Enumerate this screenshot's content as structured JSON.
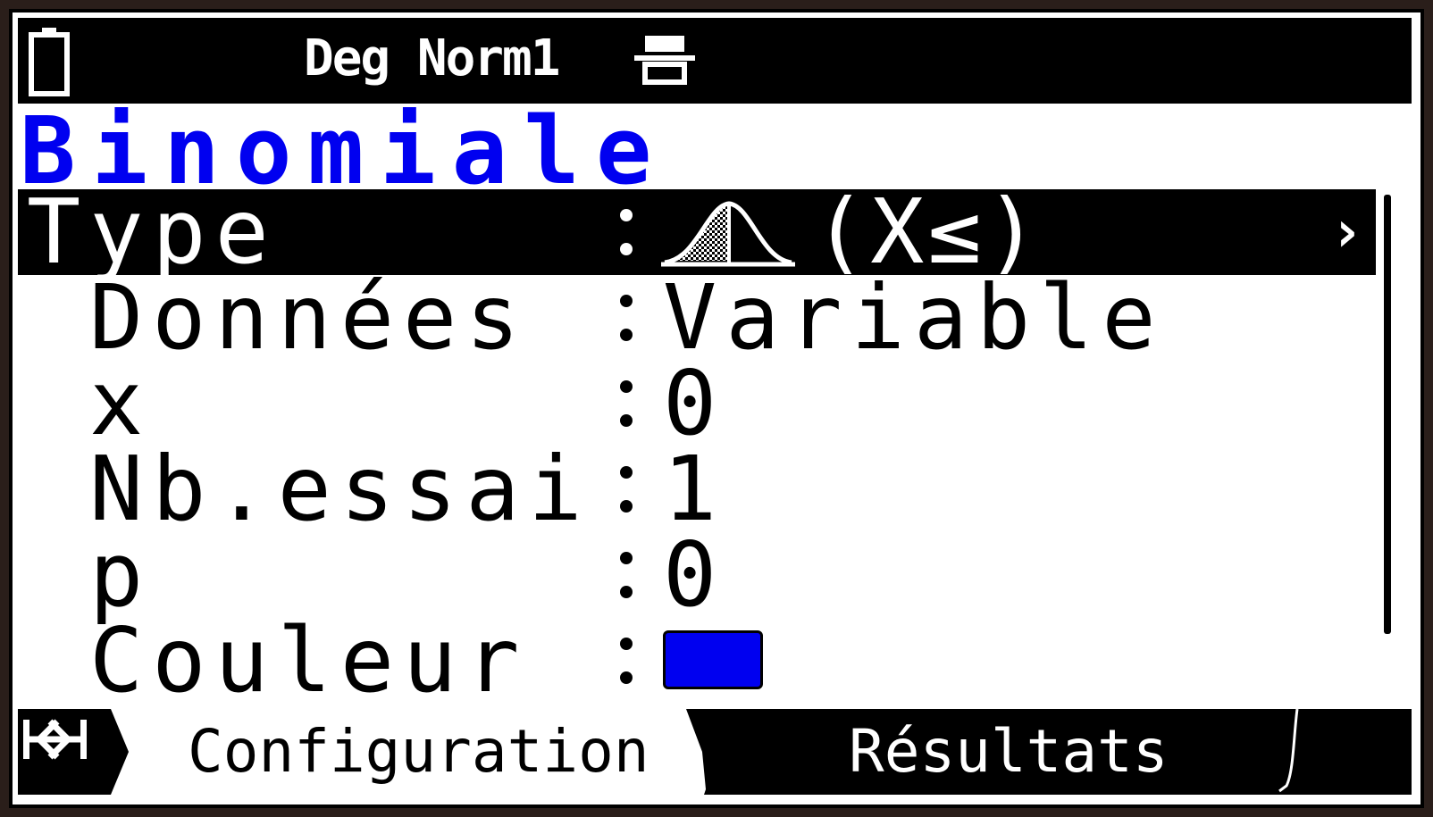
{
  "status": {
    "mode_text": "Deg Norm1",
    "battery_icon": "battery-icon",
    "extra_icon": "display-mode-icon"
  },
  "app_title": "Binomiale",
  "rows": [
    {
      "label": "Type",
      "value_condition": "(X≤)",
      "value_icon": "distribution-lower-tail-icon",
      "selected": true
    },
    {
      "label": "Données",
      "value": "Variable"
    },
    {
      "label": "x",
      "value": "0"
    },
    {
      "label": "Nb.essai",
      "value": "1"
    },
    {
      "label": "p",
      "value": "0"
    },
    {
      "label": "Couleur",
      "value_color": "#0000f0"
    }
  ],
  "tabs": {
    "left_icon": "jump-start-icon",
    "config_label": "Configuration",
    "results_label": "Résultats",
    "right_icon": "jump-end-icon"
  },
  "colors": {
    "title": "#0000f0",
    "selected_bg": "#000000",
    "swatch": "#0000f0"
  }
}
